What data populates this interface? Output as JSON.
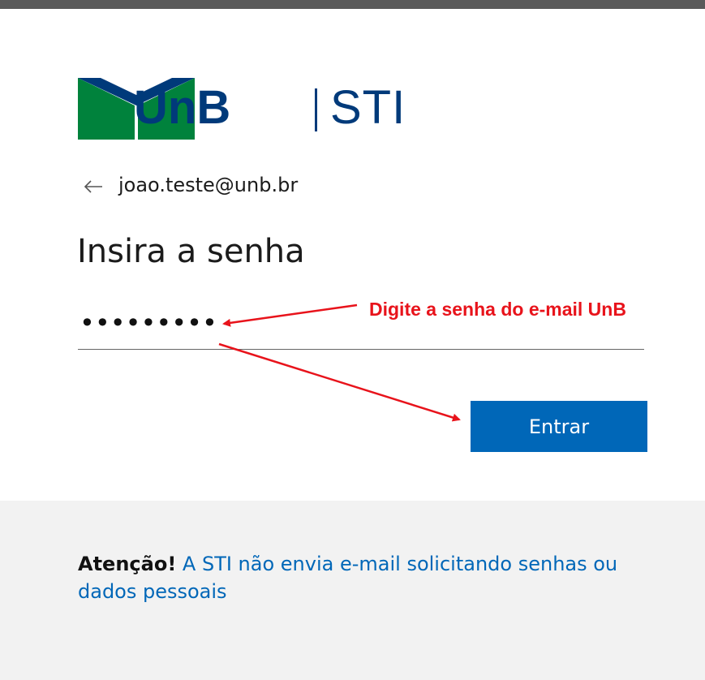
{
  "header": {
    "brand_name": "UnB",
    "brand_unit": "STI",
    "brand_color": "#003a7a",
    "logo_colors": {
      "green": "#00823c",
      "blue": "#003a7a"
    }
  },
  "identity": {
    "back_icon": "arrow-left-icon",
    "email": "joao.teste@unb.br"
  },
  "form": {
    "title": "Insira a senha",
    "password_masked": "•••••••••",
    "submit_label": "Entrar",
    "submit_color": "#0067b8"
  },
  "annotation": {
    "text": "Digite a senha do e-mail UnB",
    "color": "#e8131b"
  },
  "notice": {
    "strong": "Atenção!",
    "link_text": "A STI não envia e-mail solicitando senhas ou dados pessoais",
    "background": "#f2f2f2"
  }
}
